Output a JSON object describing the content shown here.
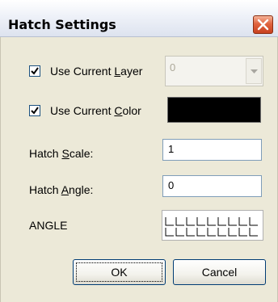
{
  "window": {
    "title": "Hatch Settings"
  },
  "layer": {
    "checked": true,
    "label_pre": "Use Current ",
    "label_key": "L",
    "label_post": "ayer",
    "combo_value": "0"
  },
  "color": {
    "checked": true,
    "label_pre": "Use Current ",
    "label_key": "C",
    "label_post": "olor",
    "swatch": "#000000"
  },
  "scale": {
    "label_pre": "Hatch ",
    "label_key": "S",
    "label_post": "cale:",
    "value": "1"
  },
  "angle": {
    "label_pre": "Hatch ",
    "label_key": "A",
    "label_post": "ngle:",
    "value": "0"
  },
  "pattern": {
    "name": "ANGLE"
  },
  "buttons": {
    "ok": "OK",
    "cancel": "Cancel"
  }
}
